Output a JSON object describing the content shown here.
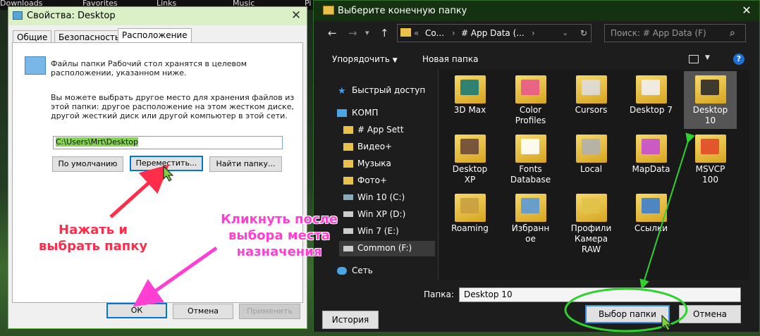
{
  "desktop": {
    "top_items": [
      "Downloads",
      "Favorites",
      "Links",
      "Music",
      "Pi"
    ]
  },
  "props_dialog": {
    "title": "Свойства: Desktop",
    "tabs": [
      "Общие",
      "Безопасность",
      "Расположение"
    ],
    "desc1_line1": "Файлы папки Рабочий стол хранятся в целевом",
    "desc1_line2": "расположении, указанном ниже.",
    "desc2_line1": "Вы можете выбрать другое место для хранения файлов из",
    "desc2_line2": "этой папки: другое расположение на этом жестком диске,",
    "desc2_line3": "другой жесткий диск или другой компьютер в этой сети.",
    "path_value": "C:\\Users\\Mrt\\Desktop",
    "btn_default": "По умолчанию",
    "btn_move": "Переместить...",
    "btn_find": "Найти папку...",
    "btn_ok": "ОК",
    "btn_cancel": "Отмена",
    "btn_apply": "Применить"
  },
  "picker": {
    "title": "Выберите конечную папку",
    "address_parts": [
      "«",
      "Co...",
      "›",
      "# App Data (...",
      "›"
    ],
    "search_placeholder": "Поиск: # App Data (F)",
    "toolbar_organize": "Упорядочить",
    "toolbar_new_folder": "Новая папка",
    "nav": [
      {
        "label": "Быстрый доступ"
      },
      {
        "label": "КОМП"
      },
      {
        "label": "# App Sett"
      },
      {
        "label": "Видео+"
      },
      {
        "label": "Музыка"
      },
      {
        "label": "Фото+"
      },
      {
        "label": "Win 10 (C:)"
      },
      {
        "label": "Win XP (D:)"
      },
      {
        "label": "Win 7 (E:)"
      },
      {
        "label": "Common (F:)"
      },
      {
        "label": "Сеть"
      }
    ],
    "folders": [
      {
        "line1": "3D Max",
        "line2": "",
        "line3": "",
        "color": "#1c7a74"
      },
      {
        "line1": "Color",
        "line2": "Profiles",
        "line3": "",
        "color": "#e85a8c"
      },
      {
        "line1": "Cursors",
        "line2": "",
        "line3": "",
        "color": "#dddddd"
      },
      {
        "line1": "Desktop 7",
        "line2": "",
        "line3": "",
        "color": "#f0f0f0"
      },
      {
        "line1": "Desktop",
        "line2": "10",
        "line3": "",
        "color": "#2a2a2a"
      },
      {
        "line1": "Desktop",
        "line2": "XP",
        "line3": "",
        "color": "#6b4a3a"
      },
      {
        "line1": "Fonts",
        "line2": "Database",
        "line3": "",
        "color": "#ffffff"
      },
      {
        "line1": "Local",
        "line2": "",
        "line3": "",
        "color": "#b0b0b0"
      },
      {
        "line1": "MapData",
        "line2": "",
        "line3": "",
        "color": "#c84fd2"
      },
      {
        "line1": "MSVCP",
        "line2": "100",
        "line3": "",
        "color": "#e24a2a"
      },
      {
        "line1": "Roaming",
        "line2": "",
        "line3": "",
        "color": "#c8a040"
      },
      {
        "line1": "Избранн",
        "line2": "ое",
        "line3": "",
        "color": "#5a9ad8"
      },
      {
        "line1": "Профили",
        "line2": "Камера",
        "line3": "RAW",
        "color": "#e0c34a"
      },
      {
        "line1": "Ссылки",
        "line2": "",
        "line3": "",
        "color": "#3c7fd0"
      }
    ],
    "folder_label": "Папка:",
    "folder_value": "Desktop 10",
    "btn_history": "История",
    "btn_select": "Выбор папки",
    "btn_cancel": "Отмена"
  },
  "annotations": {
    "red_line1": "Нажать и",
    "red_line2": "выбрать папку",
    "pink_line1": "Кликнуть после",
    "pink_line2": "выбора места",
    "pink_line3": "назначения"
  },
  "colors": {
    "red": "#ff2c4a",
    "pink": "#ff3fd3",
    "green": "#2fd12f"
  }
}
